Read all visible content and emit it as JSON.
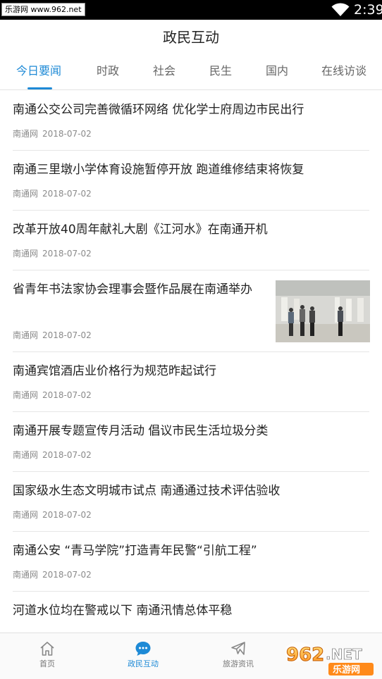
{
  "status_bar": {
    "watermark": "乐游网 www.962.net",
    "time": "2:39"
  },
  "header": {
    "title": "政民互动"
  },
  "tabs": [
    {
      "label": "今日要闻",
      "active": true
    },
    {
      "label": "时政",
      "active": false
    },
    {
      "label": "社会",
      "active": false
    },
    {
      "label": "民生",
      "active": false
    },
    {
      "label": "国内",
      "active": false
    },
    {
      "label": "在线访谈",
      "active": false
    }
  ],
  "news": [
    {
      "title": "南通公交公司完善微循环网络 优化学士府周边市民出行",
      "source": "南通网",
      "date": "2018-07-02"
    },
    {
      "title": "南通三里墩小学体育设施暂停开放 跑道维修结束将恢复",
      "source": "南通网",
      "date": "2018-07-02"
    },
    {
      "title": "改革开放40周年献礼大剧《江河水》在南通开机",
      "source": "南通网",
      "date": "2018-07-02"
    },
    {
      "title": "省青年书法家协会理事会暨作品展在南通举办",
      "source": "南通网",
      "date": "2018-07-02",
      "thumbnail": "exhibition-photo"
    },
    {
      "title": "南通宾馆酒店业价格行为规范昨起试行",
      "source": "南通网",
      "date": "2018-07-02"
    },
    {
      "title": "南通开展专题宣传月活动 倡议市民生活垃圾分类",
      "source": "南通网",
      "date": "2018-07-02"
    },
    {
      "title": "国家级水生态文明城市试点 南通通过技术评估验收",
      "source": "南通网",
      "date": "2018-07-02"
    },
    {
      "title": "南通公安 “青马学院”打造青年民警“引航工程”",
      "source": "南通网",
      "date": "2018-07-02"
    },
    {
      "title": "河道水位均在警戒以下 南通汛情总体平稳",
      "source": "",
      "date": ""
    }
  ],
  "bottom_nav": [
    {
      "label": "首页",
      "icon": "home-icon",
      "active": false
    },
    {
      "label": "政民互动",
      "icon": "chat-bubble-icon",
      "active": true
    },
    {
      "label": "旅游资讯",
      "icon": "airplane-icon",
      "active": false
    }
  ],
  "overlay_badge": {
    "brand": "962",
    "suffix": ".NET",
    "caption": "乐游网"
  },
  "colors": {
    "accent": "#1e8ad6",
    "status_bar": "#000000",
    "meta_text": "#8a8a8a",
    "divider": "#e6e6e6"
  }
}
